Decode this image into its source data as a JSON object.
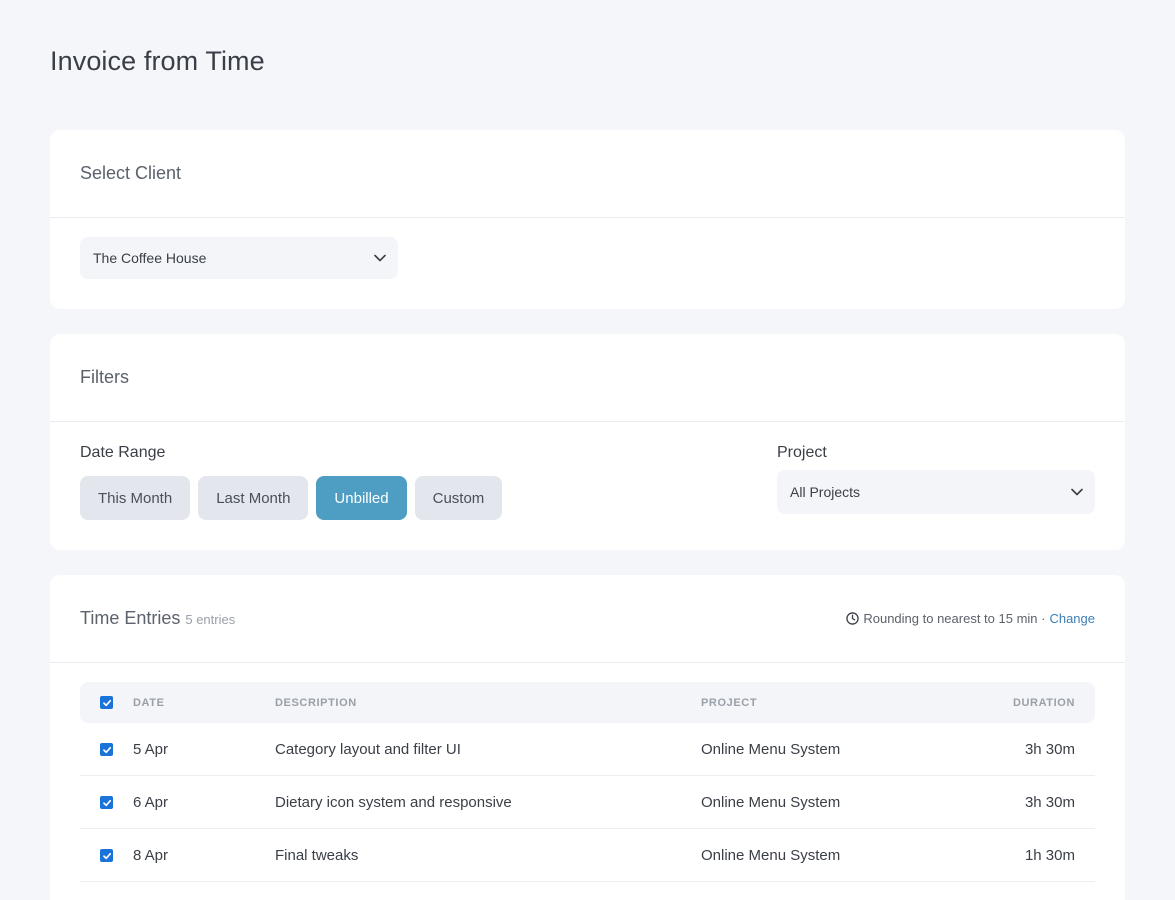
{
  "page": {
    "title": "Invoice from Time"
  },
  "client_card": {
    "title": "Select Client",
    "selected_client": "The Coffee House",
    "chevron_icon": "chevron-down-icon"
  },
  "filters_card": {
    "title": "Filters",
    "date_range_label": "Date Range",
    "date_range_options": [
      {
        "label": "This Month",
        "active": false
      },
      {
        "label": "Last Month",
        "active": false
      },
      {
        "label": "Unbilled",
        "active": true
      },
      {
        "label": "Custom",
        "active": false
      }
    ],
    "project_label": "Project",
    "selected_project": "All Projects"
  },
  "entries_card": {
    "title": "Time Entries",
    "count": "5 entries",
    "rounding_text": "Rounding to nearest to 15 min ·",
    "change_link": "Change",
    "clock_icon": "clock-icon",
    "columns": {
      "date": "DATE",
      "description": "DESCRIPTION",
      "project": "PROJECT",
      "duration": "DURATION"
    },
    "select_all_checked": true,
    "rows": [
      {
        "checked": true,
        "date": "5 Apr",
        "description": "Category layout and filter UI",
        "project": "Online Menu System",
        "duration": "3h 30m"
      },
      {
        "checked": true,
        "date": "6 Apr",
        "description": "Dietary icon system and responsive",
        "project": "Online Menu System",
        "duration": "3h 30m"
      },
      {
        "checked": true,
        "date": "8 Apr",
        "description": "Final tweaks",
        "project": "Online Menu System",
        "duration": "1h 30m"
      }
    ]
  },
  "colors": {
    "background": "#f4f6fa",
    "accent": "#4e9ec4",
    "checkbox": "#1a73d9",
    "link": "#3c7fb3"
  }
}
